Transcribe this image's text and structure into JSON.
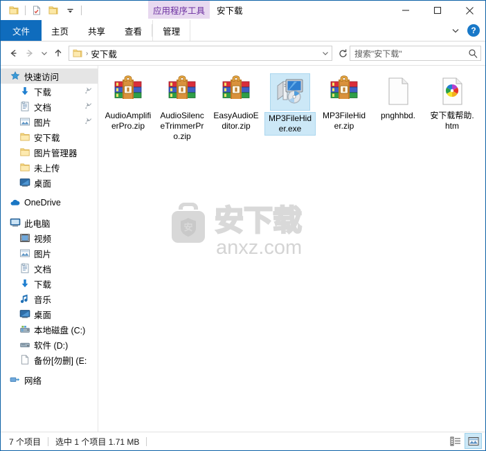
{
  "window": {
    "title": "安下载",
    "contextual_tab_group": "应用程序工具",
    "minimize_label": "最小化",
    "maximize_label": "最大化",
    "close_label": "关闭"
  },
  "quick_access_toolbar": {
    "items": [
      {
        "name": "folder-icon",
        "label": "属性"
      },
      {
        "name": "properties-icon",
        "label": "属性"
      },
      {
        "name": "new-folder-icon",
        "label": "新建文件夹"
      },
      {
        "name": "customize-dropdown-icon",
        "label": "自定义快速访问工具栏"
      }
    ]
  },
  "ribbon": {
    "tabs": [
      {
        "label": "文件",
        "active": true
      },
      {
        "label": "主页",
        "active": false
      },
      {
        "label": "共享",
        "active": false
      },
      {
        "label": "查看",
        "active": false
      },
      {
        "label": "管理",
        "active": false,
        "contextual": true
      }
    ],
    "expand_label": "展开功能区",
    "help_label": "?"
  },
  "address_bar": {
    "back_label": "后退",
    "forward_label": "前进",
    "recent_label": "最近浏览的位置",
    "up_label": "上移到",
    "path": "安下载",
    "dropdown_label": "历史记录",
    "refresh_label": "刷新"
  },
  "search": {
    "placeholder": "搜索\"安下载\""
  },
  "sidebar": {
    "items": [
      {
        "label": "快速访问",
        "icon": "star-pin-icon",
        "level": 0,
        "selected": true,
        "pinned": false
      },
      {
        "label": "下载",
        "icon": "download-arrow-icon",
        "level": 1,
        "selected": false,
        "pinned": true
      },
      {
        "label": "文档",
        "icon": "documents-icon",
        "level": 1,
        "selected": false,
        "pinned": true
      },
      {
        "label": "图片",
        "icon": "pictures-icon",
        "level": 1,
        "selected": false,
        "pinned": true
      },
      {
        "label": "安下载",
        "icon": "folder-icon",
        "level": 1,
        "selected": false,
        "pinned": false
      },
      {
        "label": "图片管理器",
        "icon": "folder-icon",
        "level": 1,
        "selected": false,
        "pinned": false
      },
      {
        "label": "未上传",
        "icon": "folder-icon",
        "level": 1,
        "selected": false,
        "pinned": false
      },
      {
        "label": "桌面",
        "icon": "desktop-icon",
        "level": 1,
        "selected": false,
        "pinned": false
      },
      {
        "label": "OneDrive",
        "icon": "onedrive-cloud-icon",
        "level": 0,
        "selected": false,
        "pinned": false,
        "gap_before": true
      },
      {
        "label": "此电脑",
        "icon": "this-pc-icon",
        "level": 0,
        "selected": false,
        "pinned": false,
        "gap_before": true
      },
      {
        "label": "视频",
        "icon": "videos-icon",
        "level": 1,
        "selected": false,
        "pinned": false
      },
      {
        "label": "图片",
        "icon": "pictures-icon",
        "level": 1,
        "selected": false,
        "pinned": false
      },
      {
        "label": "文档",
        "icon": "documents-icon",
        "level": 1,
        "selected": false,
        "pinned": false
      },
      {
        "label": "下载",
        "icon": "download-arrow-icon",
        "level": 1,
        "selected": false,
        "pinned": false
      },
      {
        "label": "音乐",
        "icon": "music-note-icon",
        "level": 1,
        "selected": false,
        "pinned": false
      },
      {
        "label": "桌面",
        "icon": "desktop-icon",
        "level": 1,
        "selected": false,
        "pinned": false
      },
      {
        "label": "本地磁盘 (C:)",
        "icon": "system-drive-icon",
        "level": 1,
        "selected": false,
        "pinned": false
      },
      {
        "label": "软件 (D:)",
        "icon": "drive-icon",
        "level": 1,
        "selected": false,
        "pinned": false
      },
      {
        "label": "备份[勿删] (E:",
        "icon": "drive-blank-icon",
        "level": 1,
        "selected": false,
        "pinned": false
      },
      {
        "label": "网络",
        "icon": "network-icon",
        "level": 0,
        "selected": false,
        "pinned": false,
        "gap_before": true
      }
    ]
  },
  "files": [
    {
      "name": "AudioAmplifierPro.zip",
      "icon": "winrar-archive-icon",
      "selected": false
    },
    {
      "name": "AudioSilenceTrimmerPro.zip",
      "icon": "winrar-archive-icon",
      "selected": false
    },
    {
      "name": "EasyAudioEditor.zip",
      "icon": "winrar-archive-icon",
      "selected": false
    },
    {
      "name": "MP3FileHider.exe",
      "icon": "application-exe-icon",
      "selected": true
    },
    {
      "name": "MP3FileHider.zip",
      "icon": "winrar-archive-icon",
      "selected": false
    },
    {
      "name": "pnghhbd.",
      "icon": "blank-document-icon",
      "selected": false
    },
    {
      "name": "安下载帮助.htm",
      "icon": "html-pinwheel-icon",
      "selected": false
    }
  ],
  "watermark": {
    "brand_text": "安下载",
    "domain_text": "anxz.com",
    "shield_char": "安"
  },
  "status_bar": {
    "item_count": "7 个项目",
    "selection": "选中 1 个项目  1.71 MB",
    "details_view_label": "详细信息",
    "large_icons_view_label": "大图标"
  },
  "colors": {
    "accent_blue": "#0f6cbd",
    "contextual_purple_bg": "#e8d9f0",
    "contextual_purple_text": "#6b2fa0",
    "selection_blue": "#cce8f7",
    "window_border": "#0a5fa5"
  }
}
